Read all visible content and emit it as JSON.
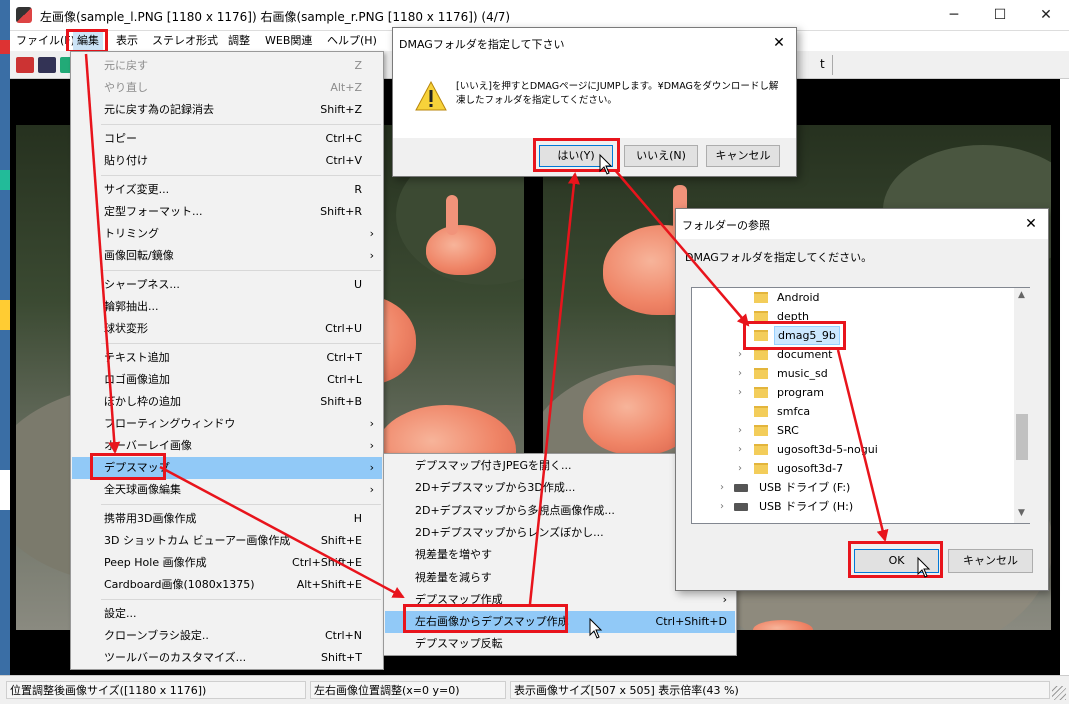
{
  "window": {
    "title": "左画像(sample_l.PNG [1180 x 1176]) 右画像(sample_r.PNG [1180 x 1176]) (4/7)",
    "minimize": "─",
    "maximize": "☐",
    "close": "✕"
  },
  "menubar": [
    "ファイル(F)",
    "編集",
    "表示",
    "ステレオ形式",
    "調整",
    "WEB関連",
    "ヘルプ(H)"
  ],
  "toolbar": {
    "trailing_text": "t"
  },
  "edit_menu": [
    {
      "label": "元に戻す",
      "shortcut": "Z",
      "disabled": true
    },
    {
      "label": "やり直し",
      "shortcut": "Alt+Z",
      "disabled": true
    },
    {
      "label": "元に戻す為の記録消去",
      "shortcut": "Shift+Z"
    },
    {
      "label": "コピー",
      "shortcut": "Ctrl+C"
    },
    {
      "label": "貼り付け",
      "shortcut": "Ctrl+V"
    },
    {
      "label": "サイズ変更...",
      "shortcut": "R"
    },
    {
      "label": "定型フォーマット...",
      "shortcut": "Shift+R"
    },
    {
      "label": "トリミング",
      "shortcut": "",
      "submenu": true
    },
    {
      "label": "画像回転/鏡像",
      "shortcut": "",
      "submenu": true
    },
    {
      "label": "シャープネス...",
      "shortcut": "U"
    },
    {
      "label": "輪郭抽出...",
      "shortcut": ""
    },
    {
      "label": "球状変形",
      "shortcut": "Ctrl+U"
    },
    {
      "label": "テキスト追加",
      "shortcut": "Ctrl+T"
    },
    {
      "label": "ロゴ画像追加",
      "shortcut": "Ctrl+L"
    },
    {
      "label": "ぼかし枠の追加",
      "shortcut": "Shift+B"
    },
    {
      "label": "フローティングウィンドウ",
      "shortcut": "",
      "submenu": true
    },
    {
      "label": "オーバーレイ画像",
      "shortcut": "",
      "submenu": true
    },
    {
      "label": "デプスマップ",
      "shortcut": "",
      "submenu": true,
      "highlighted": true
    },
    {
      "label": "全天球画像編集",
      "shortcut": "",
      "submenu": true
    },
    {
      "label": "携帯用3D画像作成",
      "shortcut": "H"
    },
    {
      "label": "3D ショットカム ビューアー画像作成",
      "shortcut": "Shift+E"
    },
    {
      "label": "Peep Hole 画像作成",
      "shortcut": "Ctrl+Shift+E"
    },
    {
      "label": "Cardboard画像(1080x1375)",
      "shortcut": "Alt+Shift+E"
    },
    {
      "label": "設定...",
      "shortcut": ""
    },
    {
      "label": "クローンブラシ設定..",
      "shortcut": "Ctrl+N"
    },
    {
      "label": "ツールバーのカスタマイズ...",
      "shortcut": "Shift+T"
    }
  ],
  "depth_submenu": [
    {
      "label": "デプスマップ付きJPEGを開く...",
      "shortcut": "Ctr"
    },
    {
      "label": "2D+デプスマップから3D作成...",
      "shortcut": ""
    },
    {
      "label": "2D+デプスマップから多視点画像作成...",
      "shortcut": "Ctr"
    },
    {
      "label": "2D+デプスマップからレンズぼかし...",
      "shortcut": "Ct"
    },
    {
      "label": "視差量を増やす",
      "shortcut": "Ctrl+"
    },
    {
      "label": "視差量を減らす",
      "shortcut": "Ctrl+Pa"
    },
    {
      "label": "デプスマップ作成",
      "shortcut": "",
      "submenu": true
    },
    {
      "label": "左右画像からデプスマップ作成",
      "shortcut": "Ctrl+Shift+D",
      "highlighted": true
    },
    {
      "label": "デプスマップ反転",
      "shortcut": ""
    }
  ],
  "dmag_dialog": {
    "title": "DMAGフォルダを指定して下さい",
    "message": "[いいえ]を押すとDMAGページにJUMPします。¥DMAGをダウンロードし解凍したフォルダを指定してください。",
    "yes": "はい(Y)",
    "no": "いいえ(N)",
    "cancel": "キャンセル"
  },
  "folder_dialog": {
    "title": "フォルダーの参照",
    "prompt": "DMAGフォルダを指定してください。",
    "items": [
      {
        "label": "Android",
        "expandable": false
      },
      {
        "label": "depth",
        "expandable": false
      },
      {
        "label": "dmag5_9b",
        "expandable": false,
        "selected": true
      },
      {
        "label": "document",
        "expandable": true
      },
      {
        "label": "music_sd",
        "expandable": true
      },
      {
        "label": "program",
        "expandable": true
      },
      {
        "label": "smfca",
        "expandable": false
      },
      {
        "label": "SRC",
        "expandable": true
      },
      {
        "label": "ugosoft3d-5-nogui",
        "expandable": true
      },
      {
        "label": "ugosoft3d-7",
        "expandable": true
      },
      {
        "label": "USB ドライブ (F:)",
        "expandable": true,
        "drive": true
      },
      {
        "label": "USB ドライブ (H:)",
        "expandable": true,
        "drive": true
      }
    ],
    "ok": "OK",
    "cancel": "キャンセル"
  },
  "statusbar": {
    "left": "位置調整後画像サイズ([1180 x 1176])",
    "middle": "左右画像位置調整(x=0 y=0)",
    "right": "表示画像サイズ[507 x 505]  表示倍率(43 %)"
  },
  "colors": {
    "annotation_red": "#e8141c",
    "highlight": "#91c9f7"
  }
}
